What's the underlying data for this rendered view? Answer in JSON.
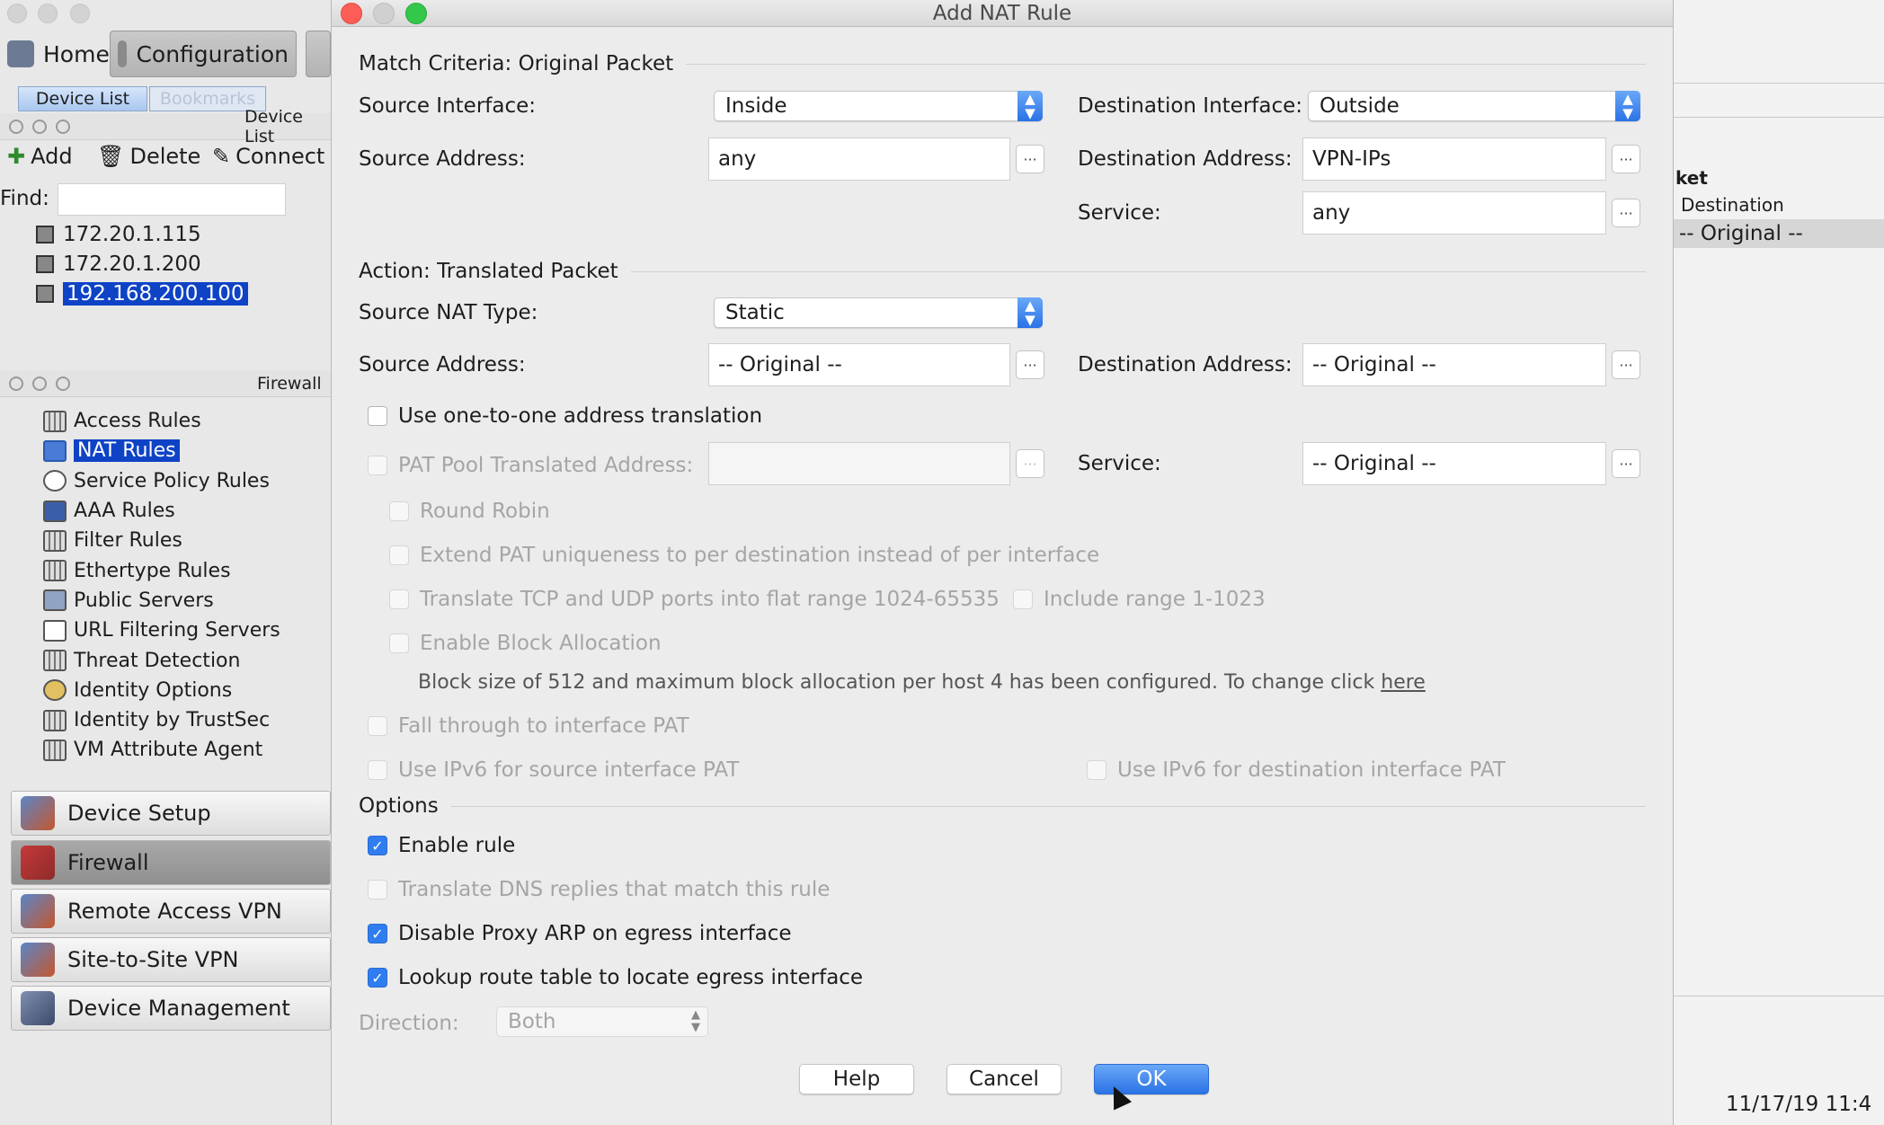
{
  "main": {
    "toolbar": {
      "home": "Home",
      "configuration": "Configuration"
    },
    "segmented": {
      "device_list": "Device List",
      "bookmarks": "Bookmarks"
    },
    "device_panel": {
      "title": "Device List",
      "add": "Add",
      "delete": "Delete",
      "connect": "Connect",
      "find_label": "Find:",
      "devices": [
        "172.20.1.115",
        "172.20.1.200",
        "192.168.200.100"
      ],
      "selected": "192.168.200.100"
    },
    "firewall_panel": {
      "title": "Firewall",
      "items": [
        "Access Rules",
        "NAT Rules",
        "Service Policy Rules",
        "AAA Rules",
        "Filter Rules",
        "Ethertype Rules",
        "Public Servers",
        "URL Filtering Servers",
        "Threat Detection",
        "Identity Options",
        "Identity by TrustSec",
        "VM Attribute Agent"
      ],
      "selected": "NAT Rules"
    },
    "nav": [
      "Device Setup",
      "Firewall",
      "Remote Access VPN",
      "Site-to-Site VPN",
      "Device Management"
    ],
    "nav_selected": "Firewall",
    "right_panel": {
      "header": "ket",
      "column": "Destination",
      "value": "-- Original --"
    },
    "status_time": "11/17/19 11:4"
  },
  "dialog": {
    "title": "Add NAT Rule",
    "match": {
      "section": "Match Criteria: Original Packet",
      "source_interface_label": "Source Interface:",
      "source_interface": "Inside",
      "destination_interface_label": "Destination Interface:",
      "destination_interface": "Outside",
      "source_address_label": "Source Address:",
      "source_address": "any",
      "destination_address_label": "Destination Address:",
      "destination_address": "VPN-IPs",
      "service_label": "Service:",
      "service": "any"
    },
    "action": {
      "section": "Action: Translated Packet",
      "source_nat_type_label": "Source NAT Type:",
      "source_nat_type": "Static",
      "source_address_label": "Source Address:",
      "source_address": "-- Original --",
      "destination_address_label": "Destination Address:",
      "destination_address": "-- Original --",
      "one_to_one": "Use one-to-one address translation",
      "pat_pool_label": "PAT Pool Translated Address:",
      "service_label": "Service:",
      "service": "-- Original --",
      "round_robin": "Round Robin",
      "extend_pat": "Extend PAT uniqueness to per destination instead of per interface",
      "translate_ports": "Translate TCP and UDP ports into flat range 1024-65535",
      "include_range": "Include range 1-1023",
      "block_allocation": "Enable Block Allocation",
      "block_note": "Block size of 512 and maximum block allocation per host 4 has been configured. To change click",
      "block_note_link": "here",
      "fall_through": "Fall through to interface PAT",
      "ipv6_source": "Use IPv6 for source interface PAT",
      "ipv6_destination": "Use IPv6 for destination interface PAT"
    },
    "options": {
      "section": "Options",
      "enable_rule": "Enable rule",
      "translate_dns": "Translate DNS replies that match this rule",
      "disable_proxy_arp": "Disable Proxy ARP on egress interface",
      "lookup_route": "Lookup route table to locate egress interface",
      "direction_label": "Direction:",
      "direction": "Both"
    },
    "buttons": {
      "help": "Help",
      "cancel": "Cancel",
      "ok": "OK"
    },
    "colors": {
      "accent": "#2f7df0",
      "close": "#fc5e57",
      "minimize": "#d0d0d0",
      "zoom": "#34c84a"
    }
  }
}
